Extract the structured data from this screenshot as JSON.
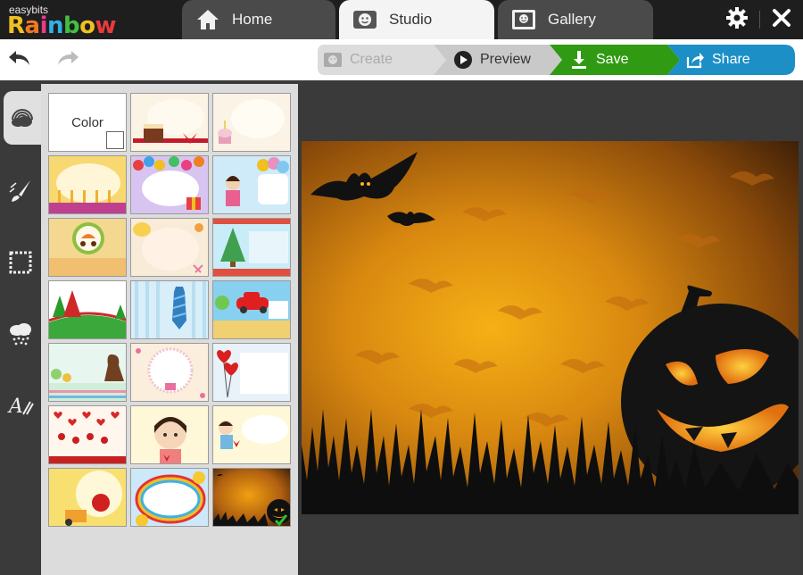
{
  "brand": {
    "small": "easybits",
    "big": "Rainbow"
  },
  "tabs": [
    {
      "label": "Home",
      "icon": "home-icon"
    },
    {
      "label": "Studio",
      "icon": "studio-icon"
    },
    {
      "label": "Gallery",
      "icon": "gallery-icon"
    }
  ],
  "window": {
    "settings_icon": "gear-icon",
    "close_icon": "close-icon"
  },
  "toolbar": {
    "undo_icon": "undo-icon",
    "redo_icon": "redo-icon"
  },
  "steps": [
    {
      "label": "Create",
      "icon": "create-icon",
      "color": "#d8d8d8"
    },
    {
      "label": "Preview",
      "icon": "play-icon",
      "color": "#c8c8c8"
    },
    {
      "label": "Save",
      "icon": "download-icon",
      "color": "#2f9a12"
    },
    {
      "label": "Share",
      "icon": "share-icon",
      "color": "#1c8fc7"
    }
  ],
  "rail": [
    {
      "name": "backgrounds",
      "icon": "rainbow-cloud-icon",
      "active": true
    },
    {
      "name": "brush",
      "icon": "brush-icon",
      "active": false
    },
    {
      "name": "frames",
      "icon": "frame-icon",
      "active": false
    },
    {
      "name": "effects",
      "icon": "rain-cloud-icon",
      "active": false
    },
    {
      "name": "text",
      "icon": "text-icon",
      "active": false
    }
  ],
  "thumbnails": {
    "color_label": "Color",
    "items": [
      "color",
      "birthday-cake",
      "cupcake",
      "candles",
      "balloons-gift",
      "girl-balloons",
      "baby-stroller",
      "baby-duck",
      "christmas-tree",
      "christmas-trees",
      "striped-tie",
      "red-car",
      "mother-child",
      "lace-frame",
      "heart-balloons",
      "hanging-hearts",
      "girl-bubble",
      "girl-cloud",
      "boxing-glove",
      "rainbow-frame",
      "halloween"
    ],
    "selected": "halloween"
  },
  "colors": {
    "titlebar": "#1e1e1e",
    "accent_green": "#2f9a12",
    "accent_blue": "#1c8fc7",
    "halloween_orange": "#f0a010"
  }
}
